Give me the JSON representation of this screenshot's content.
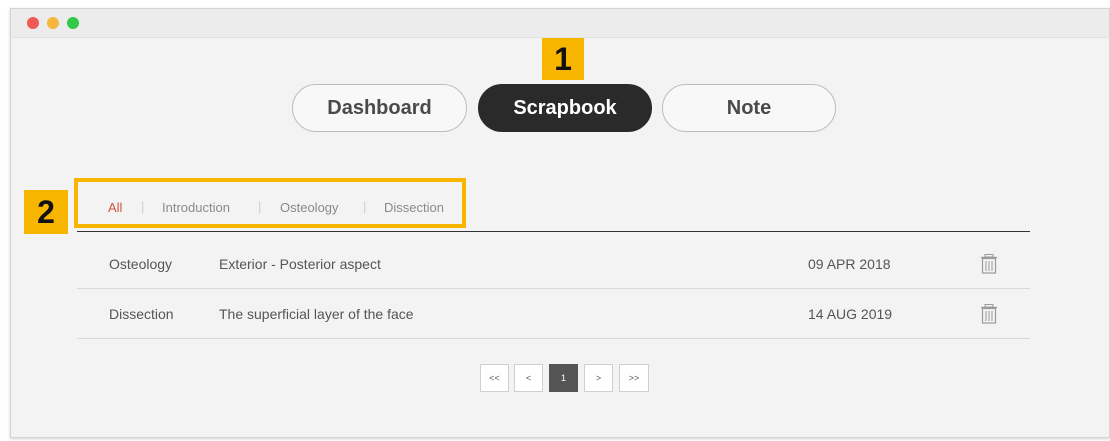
{
  "window": {
    "traffic_lights": [
      "#ee5b54",
      "#f6b73c",
      "#34c84a"
    ]
  },
  "callouts": {
    "first": "1",
    "second": "2"
  },
  "nav": {
    "tabs": [
      {
        "label": "Dashboard",
        "active": false
      },
      {
        "label": "Scrapbook",
        "active": true
      },
      {
        "label": "Note",
        "active": false
      }
    ]
  },
  "filters": {
    "items": [
      "All",
      "Introduction",
      "Osteology",
      "Dissection"
    ],
    "separator": "|",
    "active_index": 0
  },
  "list": {
    "rows": [
      {
        "category": "Osteology",
        "title": "Exterior - Posterior aspect",
        "date": "09 APR 2018",
        "action_icon": "trash-icon"
      },
      {
        "category": "Dissection",
        "title": "The superficial layer of the face",
        "date": "14 AUG 2019",
        "action_icon": "trash-icon"
      }
    ]
  },
  "pagination": {
    "first": "<<",
    "prev": "<",
    "current": "1",
    "next": ">",
    "last": ">>"
  },
  "colors": {
    "accent_callout": "#f7b500",
    "active_tab": "#2a2a2a",
    "active_filter": "#d0543f"
  }
}
